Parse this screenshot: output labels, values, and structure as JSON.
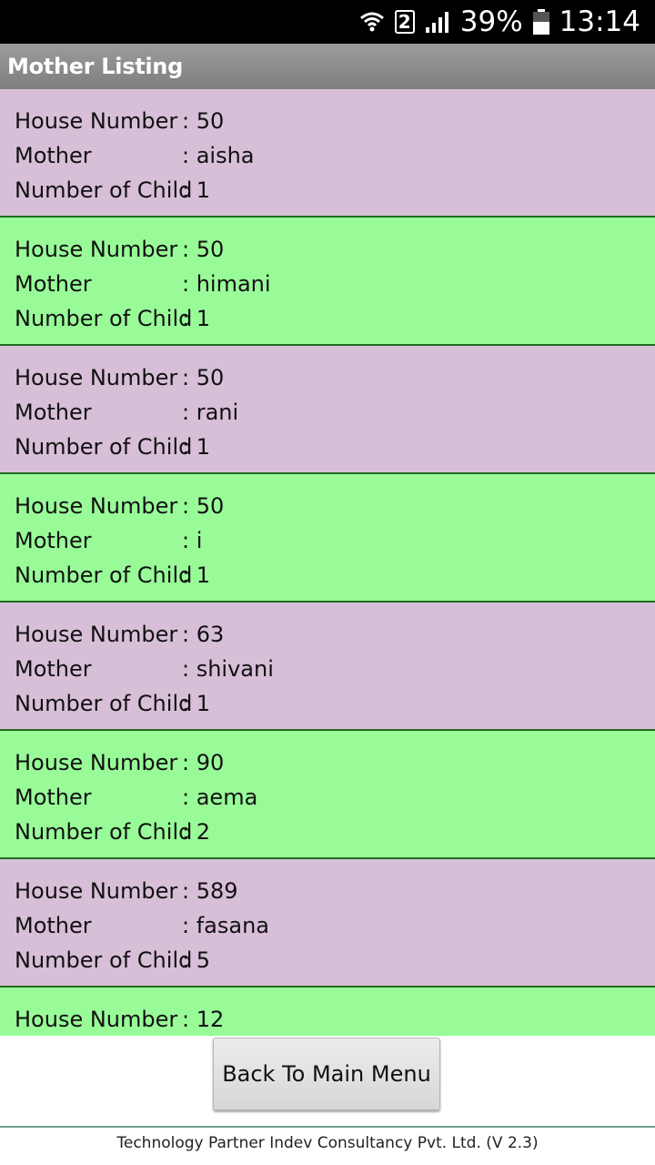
{
  "status_bar": {
    "icons": [
      "wifi-icon",
      "sim-2-icon",
      "signal-icon",
      "battery-icon"
    ],
    "sim_label": "2",
    "battery": "39%",
    "time": "13:14"
  },
  "app_title": "Mother Listing",
  "labels": {
    "house": "House Number",
    "mother": "Mother",
    "children": "Number of Child"
  },
  "records": [
    {
      "house": ": 50",
      "mother": ": aisha",
      "children": ": 1"
    },
    {
      "house": ": 50",
      "mother": ": himani",
      "children": ": 1"
    },
    {
      "house": ": 50",
      "mother": ": rani",
      "children": ": 1"
    },
    {
      "house": ": 50",
      "mother": ": i",
      "children": ": 1"
    },
    {
      "house": ": 63",
      "mother": ": shivani",
      "children": ": 1"
    },
    {
      "house": ": 90",
      "mother": ": aema",
      "children": ": 2"
    },
    {
      "house": ": 589",
      "mother": ": fasana",
      "children": ": 5"
    },
    {
      "house": ": 12",
      "mother": "",
      "children": ""
    }
  ],
  "colors": {
    "row_purple": "#d8bfd8",
    "row_green": "#98fb98",
    "app_bar": "#8a8a8a"
  },
  "back_button": "Back To Main Menu",
  "footer_text": "Technology Partner Indev Consultancy Pvt. Ltd. (V 2.3)"
}
